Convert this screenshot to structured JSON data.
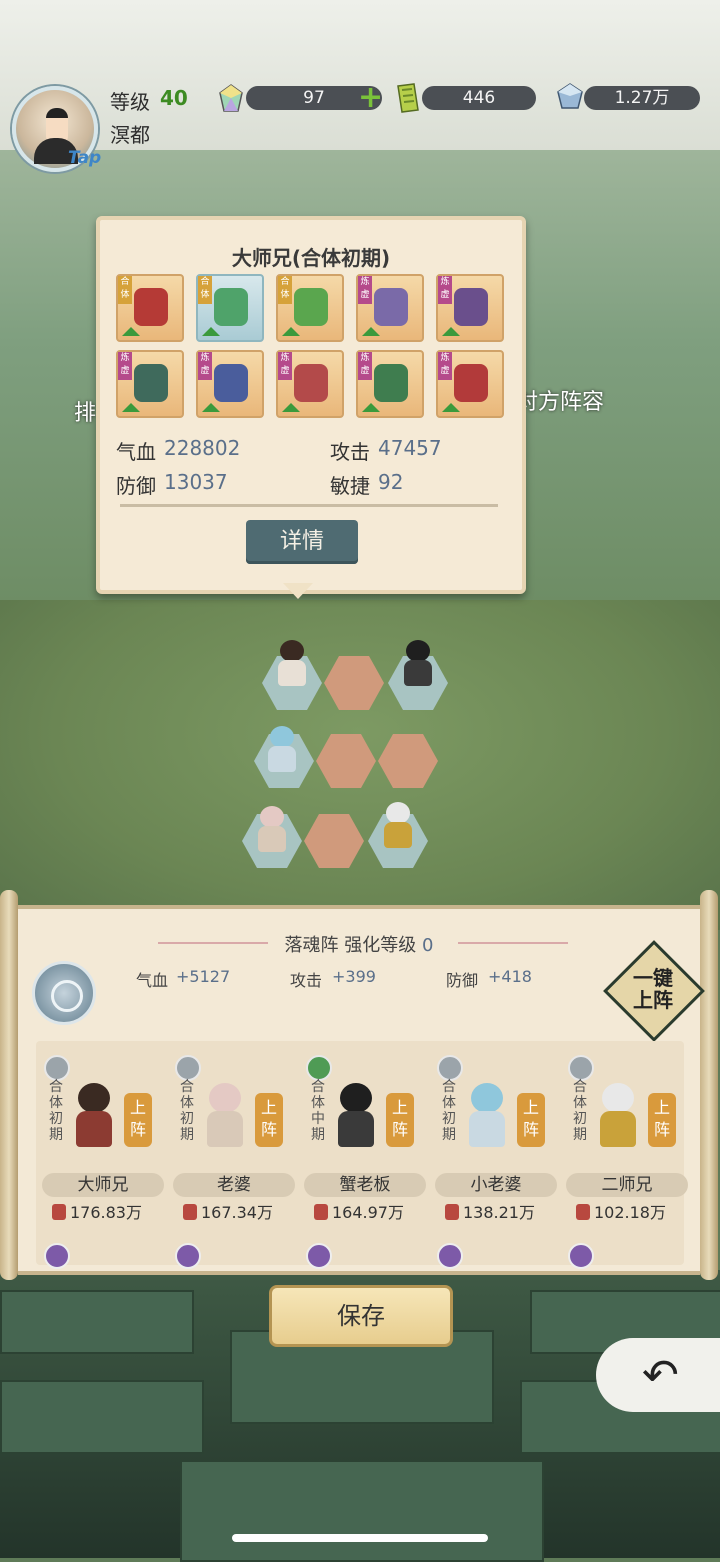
{
  "player": {
    "avatar_badge": "Tap",
    "level_label": "等级",
    "level": "40",
    "region": "溟都"
  },
  "resources": [
    {
      "icon": "rainbow-crystal-icon",
      "value": "97",
      "plus": "+"
    },
    {
      "icon": "green-scroll-icon",
      "value": "446"
    },
    {
      "icon": "blue-gem-icon",
      "value": "1.27万"
    }
  ],
  "side_labels": {
    "left": "排",
    "right": "对方阵容"
  },
  "popup": {
    "title": "大师兄(合体初期)",
    "equipment": [
      {
        "tag": "合体",
        "tag_color": "gold",
        "item": "sword",
        "color": "#b53a36"
      },
      {
        "tag": "合体",
        "tag_color": "gold",
        "item": "jade-blade",
        "color": "#4fa36a",
        "frame": "blue"
      },
      {
        "tag": "合体",
        "tag_color": "gold",
        "item": "green-blade",
        "color": "#5aa64e"
      },
      {
        "tag": "炼虚",
        "tag_color": "purple",
        "item": "robe",
        "color": "#7a6aa8"
      },
      {
        "tag": "炼虚",
        "tag_color": "purple",
        "item": "boots",
        "color": "#6a4f8c"
      },
      {
        "tag": "炼虚",
        "tag_color": "purple",
        "item": "staff",
        "color": "#3f6a5c"
      },
      {
        "tag": "炼虚",
        "tag_color": "purple",
        "item": "beads",
        "color": "#4a5d9c"
      },
      {
        "tag": "炼虚",
        "tag_color": "purple",
        "item": "armor",
        "color": "#b34a4a"
      },
      {
        "tag": "炼虚",
        "tag_color": "purple",
        "item": "helmet",
        "color": "#3f7d4f"
      },
      {
        "tag": "炼虚",
        "tag_color": "purple",
        "item": "ring",
        "color": "#b23a3a"
      }
    ],
    "stats": [
      {
        "label": "气血",
        "value": "228802"
      },
      {
        "label": "攻击",
        "value": "47457"
      },
      {
        "label": "防御",
        "value": "13037"
      },
      {
        "label": "敏捷",
        "value": "92"
      }
    ],
    "detail_button": "详情"
  },
  "formation": {
    "title": "落魂阵 强化等级",
    "level": "0",
    "bonuses": [
      {
        "label": "气血",
        "value": "+5127"
      },
      {
        "label": "攻击",
        "value": "+399"
      },
      {
        "label": "防御",
        "value": "+418"
      }
    ],
    "one_key_label": "一键上阵"
  },
  "heroes": [
    {
      "name": "大师兄",
      "realm": "合体初期",
      "power": "176.83万",
      "deploy": "上阵",
      "element": "grey",
      "hair": "#3a2a22",
      "robe": "#8c3b32"
    },
    {
      "name": "老婆",
      "realm": "合体初期",
      "power": "167.34万",
      "deploy": "上阵",
      "element": "grey",
      "hair": "#e4c9c4",
      "robe": "#d9c9b8"
    },
    {
      "name": "蟹老板",
      "realm": "合体中期",
      "power": "164.97万",
      "deploy": "上阵",
      "element": "green",
      "hair": "#1f1f1f",
      "robe": "#3a3a3a"
    },
    {
      "name": "小老婆",
      "realm": "合体初期",
      "power": "138.21万",
      "deploy": "上阵",
      "element": "grey",
      "hair": "#8fc7dc",
      "robe": "#c9d9e2"
    },
    {
      "name": "二师兄",
      "realm": "合体初期",
      "power": "102.18万",
      "deploy": "上阵",
      "element": "grey",
      "hair": "#e8e8e8",
      "robe": "#c9a23a"
    }
  ],
  "save_button": "保存",
  "back_icon": "back-arrow-icon"
}
